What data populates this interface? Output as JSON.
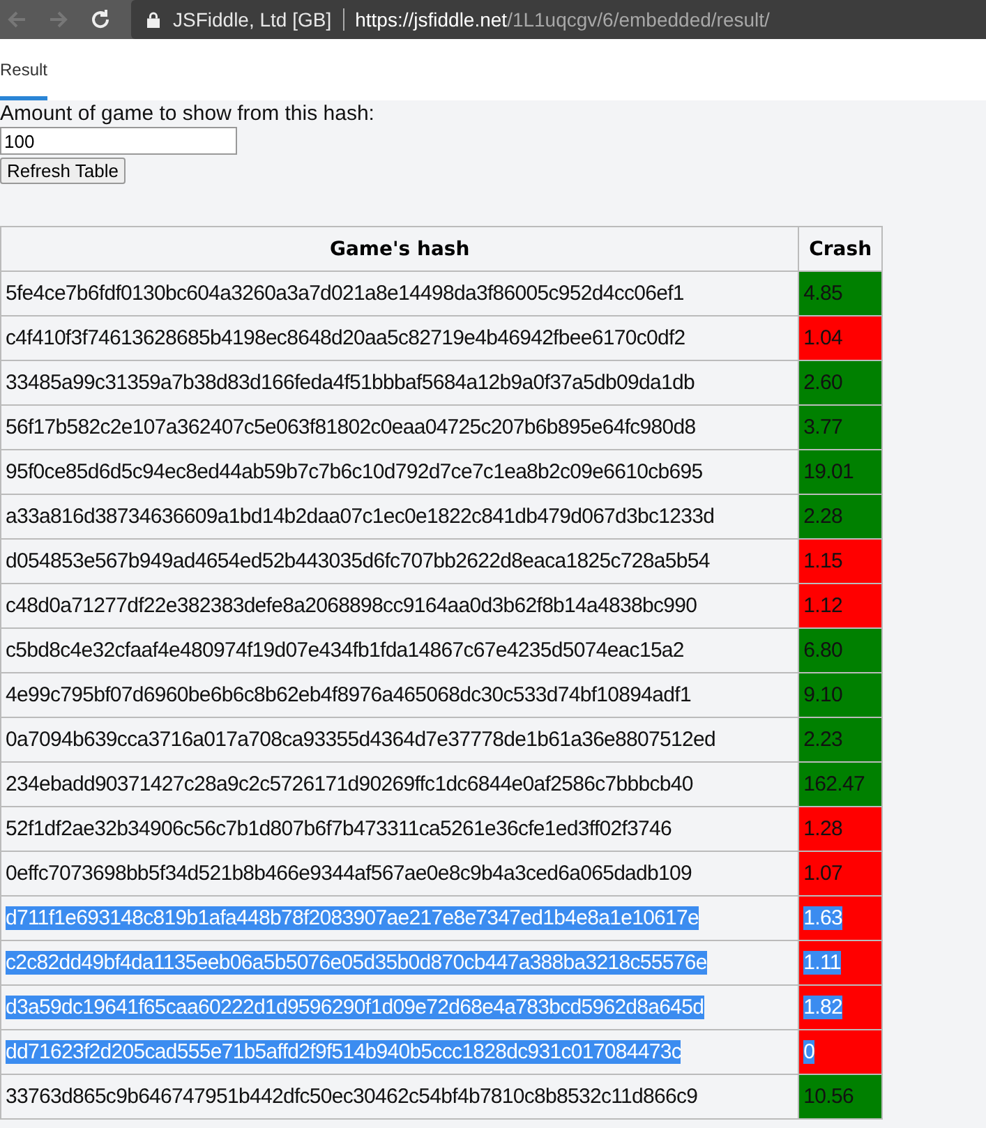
{
  "browser": {
    "site_identity": "JSFiddle, Ltd [GB]",
    "url_host": "https://jsfiddle.net",
    "url_path": "/1L1uqcgv/6/embedded/result/"
  },
  "tabs": [
    {
      "label": "Result",
      "selected": true
    }
  ],
  "form": {
    "label": "Amount of game to show from this hash:",
    "value": "100",
    "button": "Refresh Table"
  },
  "table": {
    "columns": [
      "Game's hash",
      "Crash"
    ],
    "rows": [
      {
        "hash": "5fe4ce7b6fdf0130bc604a3260a3a7d021a8e14498da3f86005c952d4cc06ef1",
        "crash": "4.85",
        "color": "#008000",
        "selected": false
      },
      {
        "hash": "c4f410f3f74613628685b4198ec8648d20aa5c82719e4b46942fbee6170c0df2",
        "crash": "1.04",
        "color": "#ff0000",
        "selected": false
      },
      {
        "hash": "33485a99c31359a7b38d83d166feda4f51bbbaf5684a12b9a0f37a5db09da1db",
        "crash": "2.60",
        "color": "#008000",
        "selected": false
      },
      {
        "hash": "56f17b582c2e107a362407c5e063f81802c0eaa04725c207b6b895e64fc980d8",
        "crash": "3.77",
        "color": "#008000",
        "selected": false
      },
      {
        "hash": "95f0ce85d6d5c94ec8ed44ab59b7c7b6c10d792d7ce7c1ea8b2c09e6610cb695",
        "crash": "19.01",
        "color": "#008000",
        "selected": false
      },
      {
        "hash": "a33a816d38734636609a1bd14b2daa07c1ec0e1822c841db479d067d3bc1233d",
        "crash": "2.28",
        "color": "#008000",
        "selected": false
      },
      {
        "hash": "d054853e567b949ad4654ed52b443035d6fc707bb2622d8eaca1825c728a5b54",
        "crash": "1.15",
        "color": "#ff0000",
        "selected": false
      },
      {
        "hash": "c48d0a71277df22e382383defe8a2068898cc9164aa0d3b62f8b14a4838bc990",
        "crash": "1.12",
        "color": "#ff0000",
        "selected": false
      },
      {
        "hash": "c5bd8c4e32cfaaf4e480974f19d07e434fb1fda14867c67e4235d5074eac15a2",
        "crash": "6.80",
        "color": "#008000",
        "selected": false
      },
      {
        "hash": "4e99c795bf07d6960be6b6c8b62eb4f8976a465068dc30c533d74bf10894adf1",
        "crash": "9.10",
        "color": "#008000",
        "selected": false
      },
      {
        "hash": "0a7094b639cca3716a017a708ca93355d4364d7e37778de1b61a36e8807512ed",
        "crash": "2.23",
        "color": "#008000",
        "selected": false
      },
      {
        "hash": "234ebadd90371427c28a9c2c5726171d90269ffc1dc6844e0af2586c7bbbcb40",
        "crash": "162.47",
        "color": "#008000",
        "selected": false
      },
      {
        "hash": "52f1df2ae32b34906c56c7b1d807b6f7b473311ca5261e36cfe1ed3ff02f3746",
        "crash": "1.28",
        "color": "#ff0000",
        "selected": false
      },
      {
        "hash": "0effc7073698bb5f34d521b8b466e9344af567ae0e8c9b4a3ced6a065dadb109",
        "crash": "1.07",
        "color": "#ff0000",
        "selected": false
      },
      {
        "hash": "d711f1e693148c819b1afa448b78f2083907ae217e8e7347ed1b4e8a1e10617e",
        "crash": "1.63",
        "color": "#ff0000",
        "selected": true
      },
      {
        "hash": "c2c82dd49bf4da1135eeb06a5b5076e05d35b0d870cb447a388ba3218c55576e",
        "crash": "1.11",
        "color": "#ff0000",
        "selected": true
      },
      {
        "hash": "d3a59dc19641f65caa60222d1d9596290f1d09e72d68e4a783bcd5962d8a645d",
        "crash": "1.82",
        "color": "#ff0000",
        "selected": true
      },
      {
        "hash": "dd71623f2d205cad555e71b5affd2f9f514b940b5ccc1828dc931c017084473c",
        "crash": "0",
        "color": "#ff0000",
        "selected": true
      },
      {
        "hash": "33763d865c9b646747951b442dfc50ec30462c54bf4b7810c8b8532c11d866c9",
        "crash": "10.56",
        "color": "#008000",
        "selected": false
      }
    ]
  }
}
